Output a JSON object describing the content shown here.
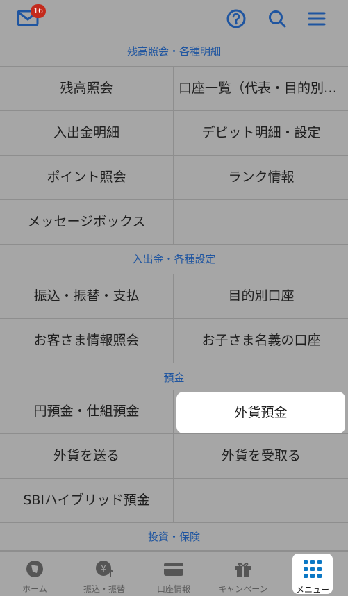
{
  "header": {
    "badge_count": "16",
    "icons": [
      "mail-icon",
      "help-icon",
      "search-icon",
      "hamburger-menu-icon"
    ]
  },
  "sections": [
    {
      "title": "残高照会・各種明細",
      "rows": [
        [
          "残高照会",
          "口座一覧（代表・目的別口座）"
        ],
        [
          "入出金明細",
          "デビット明細・設定"
        ],
        [
          "ポイント照会",
          "ランク情報"
        ],
        [
          "メッセージボックス",
          ""
        ]
      ]
    },
    {
      "title": "入出金・各種設定",
      "rows": [
        [
          "振込・振替・支払",
          "目的別口座"
        ],
        [
          "お客さま情報照会",
          "お子さま名義の口座"
        ]
      ]
    },
    {
      "title": "預金",
      "rows": [
        [
          "円預金・仕組預金",
          "外貨預金"
        ],
        [
          "外貨を送る",
          "外貨を受取る"
        ],
        [
          "SBIハイブリッド預金",
          ""
        ]
      ]
    },
    {
      "title": "投資・保険",
      "rows": []
    }
  ],
  "tabbar": [
    {
      "label": "ホーム",
      "icon": "home-icon"
    },
    {
      "label": "振込・振替",
      "icon": "transfer-icon"
    },
    {
      "label": "口座情報",
      "icon": "card-icon"
    },
    {
      "label": "キャンペーン",
      "icon": "gift-icon"
    },
    {
      "label": "メニュー",
      "icon": "grid-menu-icon",
      "active": true
    }
  ],
  "colors": {
    "accent": "#1f55a0",
    "badge": "#c42a1c",
    "overlay": "#a6a6a6",
    "active_tab": "#0b78c5"
  }
}
